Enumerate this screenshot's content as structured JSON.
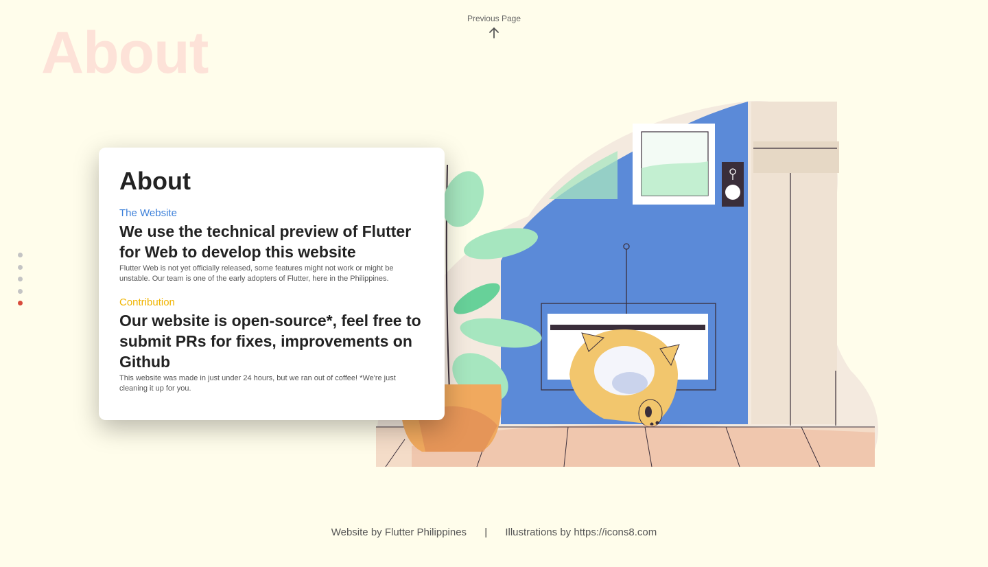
{
  "nav": {
    "previous_page_label": "Previous Page"
  },
  "background_title": "About",
  "page_indicator": {
    "total": 5,
    "active_index": 4
  },
  "card": {
    "title": "About",
    "sections": [
      {
        "label": "The Website",
        "label_color": "#3b7fd9",
        "heading": "We use the technical preview of Flutter for Web to develop this website",
        "body": "Flutter Web is not yet officially released, some features might not work or might be unstable. Our team is one of the early adopters of Flutter, here in the Philippines."
      },
      {
        "label": "Contribution",
        "label_color": "#f0b400",
        "heading": "Our website is open-source*, feel free to submit PRs for fixes, improvements on Github",
        "body": "This website was made in just under 24 hours, but we ran out of coffee! *We're just cleaning it up for you."
      }
    ]
  },
  "footer": {
    "credit_left": "Website by Flutter Philippines",
    "separator": "|",
    "credit_right": "Illustrations by https://icons8.com"
  },
  "colors": {
    "background": "#fffdeb",
    "background_title": "#fde2d8",
    "active_dot": "#d84b3c",
    "inactive_dot": "#c4c4c4",
    "wall_blue": "#5b8ad8",
    "cat": "#f2c66d"
  }
}
